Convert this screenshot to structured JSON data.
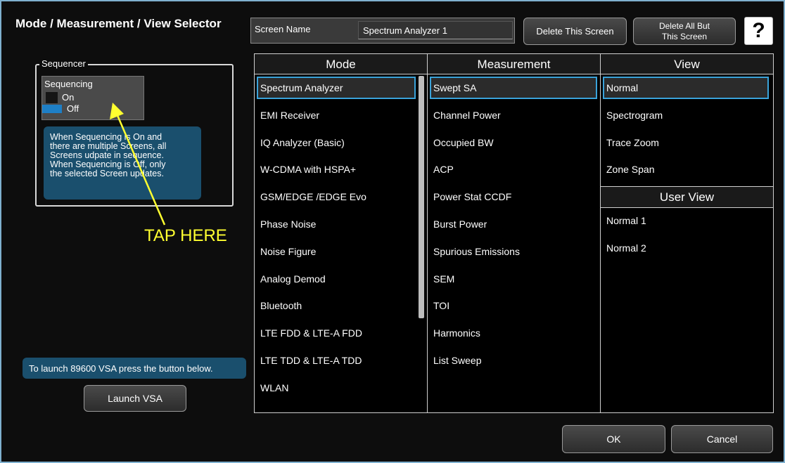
{
  "window": {
    "title": "Mode / Measurement / View Selector"
  },
  "screen_name": {
    "label": "Screen Name",
    "value": "Spectrum Analyzer 1"
  },
  "buttons": {
    "delete_screen": "Delete This Screen",
    "delete_all_line1": "Delete All But",
    "delete_all_line2": "This Screen",
    "help": "?",
    "launch_vsa": "Launch VSA",
    "ok": "OK",
    "cancel": "Cancel"
  },
  "sequencer": {
    "legend": "Sequencer",
    "toggle_label": "Sequencing",
    "on_label": "On",
    "off_label": "Off",
    "selected": "Off",
    "info_lines": [
      "When Sequencing is On and",
      "there are multiple Screens, all",
      "Screens udpate in sequence.",
      "When Sequencing is Off, only",
      "the selected Screen updates."
    ],
    "annotation": "TAP HERE"
  },
  "vsa_info": "To launch 89600 VSA press the button below.",
  "mode": {
    "header": "Mode",
    "selected": "Spectrum Analyzer",
    "items": [
      "Spectrum Analyzer",
      "EMI Receiver",
      "IQ Analyzer (Basic)",
      "W-CDMA with HSPA+",
      "GSM/EDGE /EDGE Evo",
      "Phase Noise",
      "Noise Figure",
      "Analog Demod",
      "Bluetooth",
      "LTE FDD & LTE-A FDD",
      "LTE TDD & LTE-A TDD",
      "WLAN"
    ]
  },
  "measurement": {
    "header": "Measurement",
    "selected": "Swept SA",
    "items": [
      "Swept SA",
      "Channel Power",
      "Occupied BW",
      "ACP",
      "Power Stat CCDF",
      "Burst Power",
      "Spurious Emissions",
      "SEM",
      "TOI",
      "Harmonics",
      "List Sweep"
    ]
  },
  "view": {
    "header": "View",
    "selected": "Normal",
    "items": [
      "Normal",
      "Spectrogram",
      "Trace Zoom",
      "Zone Span"
    ],
    "user_view_header": "User View",
    "user_items": [
      "Normal 1",
      "Normal 2"
    ]
  },
  "colors": {
    "selection_border": "#3aa3da",
    "info_bg": "#1a4f6d",
    "annotation": "#ffff30",
    "toggle_off": "#1e7fc6"
  }
}
